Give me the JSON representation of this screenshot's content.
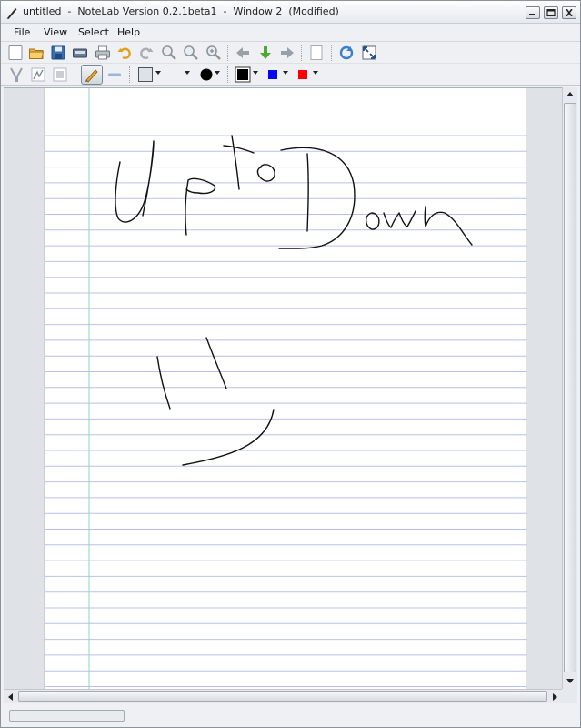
{
  "window": {
    "title": "untitled  -  NoteLab Version 0.2.1beta1  -  Window 2  (Modified)"
  },
  "menu": [
    "File",
    "View",
    "Select",
    "Help"
  ],
  "toolbar_main": {
    "icons": [
      "new-page-icon",
      "open-folder-icon",
      "save-icon",
      "scan-icon",
      "print-icon",
      "undo-icon",
      "redo-icon",
      "zoom-in-icon",
      "zoom-out-icon",
      "zoom-reset-icon",
      "arrow-left-icon",
      "arrow-down-icon",
      "arrow-right-icon",
      "blank-page-icon",
      "refresh-icon",
      "fullscreen-icon"
    ]
  },
  "toolbar_tools": {
    "icons": [
      "select-tool-icon",
      "stroke-tool-icon",
      "eraser-tool-icon",
      "pen-tool-icon",
      "line-tool-icon"
    ],
    "active_tool": "pen",
    "pen_color": "#000000",
    "highlight_color": "#0000ff",
    "alt_color": "#ff0000"
  },
  "colors": {
    "paper": "#ffffff",
    "rule_line": "#b8c2e6",
    "margin_line": "#8cd6c0",
    "ink": "#111111"
  }
}
